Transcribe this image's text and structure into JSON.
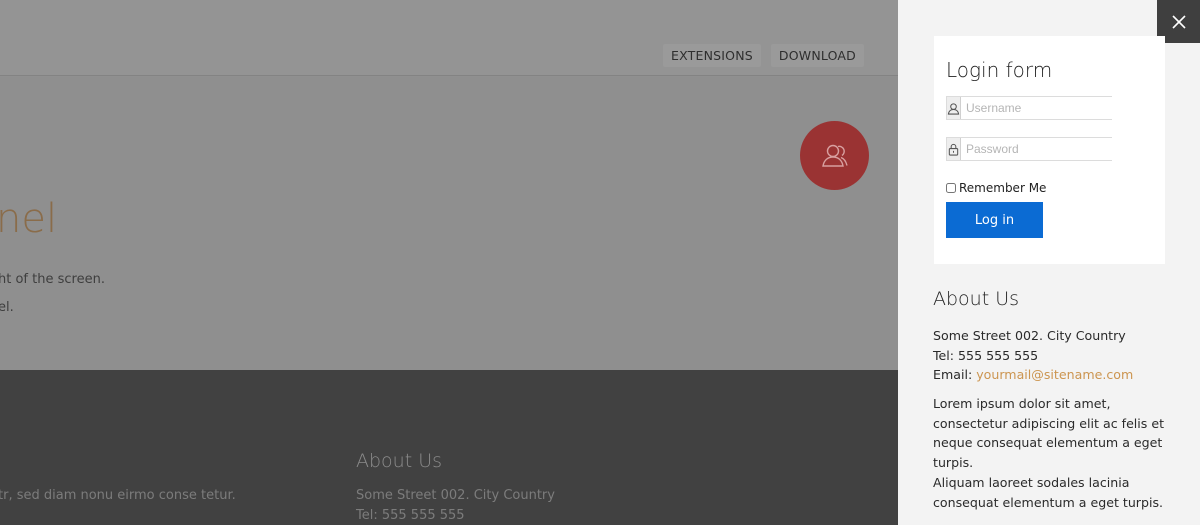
{
  "background": {
    "nav": [
      "EXTENSIONS",
      "DOWNLOAD"
    ],
    "heading_fragment": "nel",
    "text_line_1": "ht of the screen.",
    "text_line_2": "el.",
    "footer": {
      "text_fragment": "tr, sed diam nonu eirmo conse tetur.",
      "about_title": "About Us",
      "address": "Some Street 002. City Country",
      "tel": "Tel: 555 555 555"
    }
  },
  "panel": {
    "login": {
      "title": "Login form",
      "username_placeholder": "Username",
      "password_placeholder": "Password",
      "remember_label": "Remember Me",
      "login_button": "Log in"
    },
    "about": {
      "title": "About Us",
      "address": "Some Street 002. City Country",
      "tel": "Tel: 555 555 555",
      "email_label": "Email:",
      "email": "yourmail@sitename.com",
      "paragraph_1": "Lorem ipsum dolor sit amet, consectetur adipiscing elit ac felis et neque consequat elementum a eget turpis.",
      "paragraph_2": "Aliquam laoreet sodales lacinia consequat elementum a eget turpis."
    }
  },
  "colors": {
    "overlay_page": "#909090",
    "panel_bg": "#f3f3f3",
    "accent_red": "#9a3333",
    "login_button": "#0b6bd3",
    "email_link": "#cc9550",
    "footer_bg": "#414141"
  }
}
